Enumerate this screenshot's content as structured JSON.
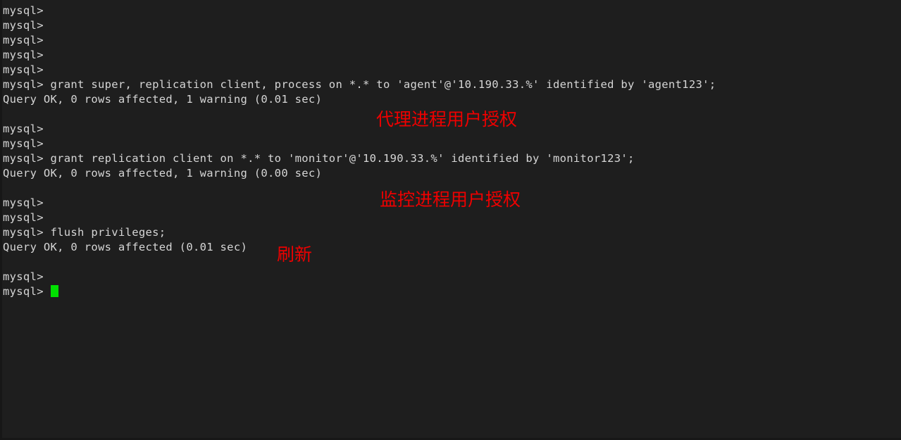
{
  "terminal": {
    "background_color": "#1e1e1e",
    "text_color": "#d6d6d6",
    "cursor_color": "#00e000",
    "annotation_color": "#ee0000",
    "prompt": "mysql>",
    "lines": [
      {
        "id": "line-1",
        "text": "mysql>"
      },
      {
        "id": "line-2",
        "text": "mysql>"
      },
      {
        "id": "line-3",
        "text": "mysql>"
      },
      {
        "id": "line-4",
        "text": "mysql>"
      },
      {
        "id": "line-5",
        "text": "mysql>"
      },
      {
        "id": "line-6",
        "text": "mysql> grant super, replication client, process on *.* to 'agent'@'10.190.33.%' identified by 'agent123';"
      },
      {
        "id": "line-7",
        "text": "Query OK, 0 rows affected, 1 warning (0.01 sec)"
      },
      {
        "id": "line-8",
        "text": ""
      },
      {
        "id": "line-9",
        "text": "mysql>"
      },
      {
        "id": "line-10",
        "text": "mysql>"
      },
      {
        "id": "line-11",
        "text": "mysql> grant replication client on *.* to 'monitor'@'10.190.33.%' identified by 'monitor123';"
      },
      {
        "id": "line-12",
        "text": "Query OK, 0 rows affected, 1 warning (0.00 sec)"
      },
      {
        "id": "line-13",
        "text": ""
      },
      {
        "id": "line-14",
        "text": "mysql>"
      },
      {
        "id": "line-15",
        "text": "mysql>"
      },
      {
        "id": "line-16",
        "text": "mysql> flush privileges;"
      },
      {
        "id": "line-17",
        "text": "Query OK, 0 rows affected (0.01 sec)"
      },
      {
        "id": "line-18",
        "text": ""
      },
      {
        "id": "line-19",
        "text": "mysql>"
      },
      {
        "id": "line-20",
        "text": "mysql> "
      }
    ]
  },
  "annotations": {
    "agent_grant": "代理进程用户授权",
    "monitor_grant": "监控进程用户授权",
    "flush": "刷新"
  }
}
